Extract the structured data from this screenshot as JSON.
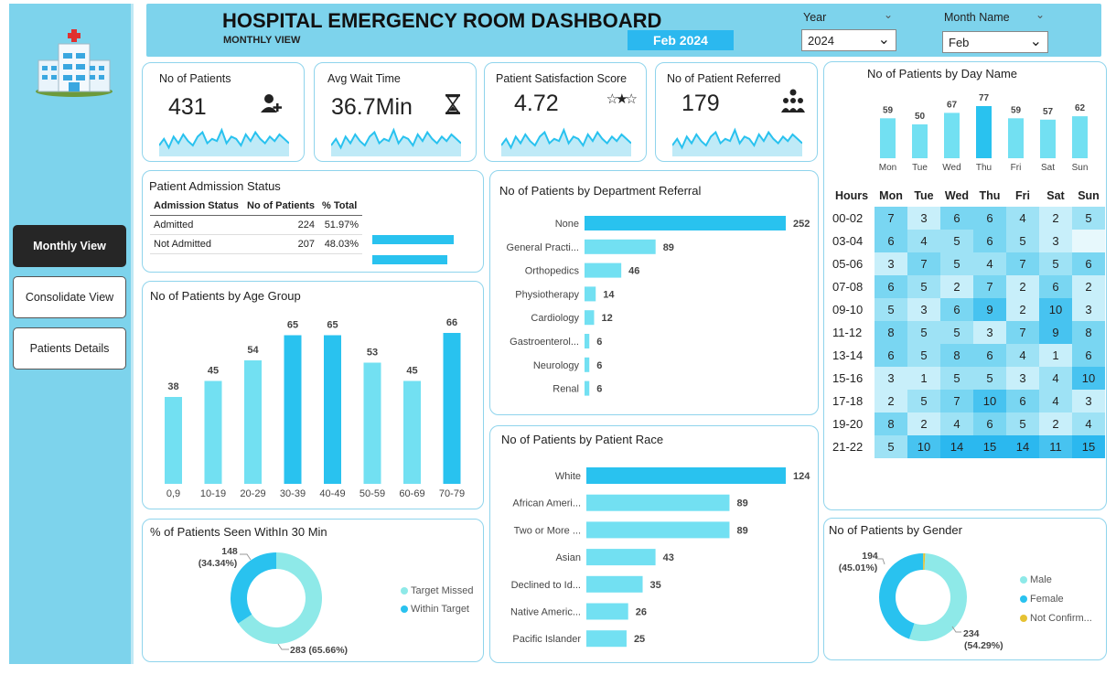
{
  "header": {
    "title": "HOSPITAL EMERGENCY ROOM DASHBOARD",
    "subtitle": "MONTHLY VIEW",
    "period_badge": "Feb 2024",
    "year_label": "Year",
    "year_value": "2024",
    "month_label": "Month Name",
    "month_value": "Feb"
  },
  "nav": {
    "items": [
      "Monthly View",
      "Consolidate View",
      "Patients Details"
    ],
    "active": 0
  },
  "kpis": [
    {
      "label": "No of Patients",
      "value": "431",
      "icon": "add-user-icon"
    },
    {
      "label": "Avg Wait Time",
      "value": "36.7Min",
      "icon": "hourglass-icon"
    },
    {
      "label": "Patient Satisfaction Score",
      "value": "4.72",
      "icon": "stars-icon"
    },
    {
      "label": "No of Patient Referred",
      "value": "179",
      "icon": "group-icon"
    }
  ],
  "admission": {
    "title": "Patient Admission Status",
    "columns": [
      "Admission Status",
      "No of Patients",
      "% Total"
    ],
    "rows": [
      {
        "status": "Admitted",
        "count": 224,
        "pct": "51.97%"
      },
      {
        "status": "Not Admitted",
        "count": 207,
        "pct": "48.03%"
      }
    ]
  },
  "colors": {
    "accent": "#7dd3ec",
    "bar_dark": "#29c2ef",
    "bar_light": "#72e0f2",
    "badge": "#2bb8ef",
    "missed": "#8ee9e8",
    "within": "#29c2ef",
    "notconfirmed": "#e6c233"
  },
  "chart_data": [
    {
      "id": "age",
      "type": "bar",
      "title": "No of Patients by Age Group",
      "categories": [
        "0,9",
        "10-19",
        "20-29",
        "30-39",
        "40-49",
        "50-59",
        "60-69",
        "70-79"
      ],
      "values": [
        38,
        45,
        54,
        65,
        65,
        53,
        45,
        66
      ]
    },
    {
      "id": "dept",
      "type": "bar",
      "orientation": "horizontal",
      "title": "No of Patients by Department Referral",
      "categories": [
        "None",
        "General Practi...",
        "Orthopedics",
        "Physiotherapy",
        "Cardiology",
        "Gastroenterol...",
        "Neurology",
        "Renal"
      ],
      "values": [
        252,
        89,
        46,
        14,
        12,
        6,
        6,
        6
      ]
    },
    {
      "id": "race",
      "type": "bar",
      "orientation": "horizontal",
      "title": "No of Patients by Patient Race",
      "categories": [
        "White",
        "African Ameri...",
        "Two or More ...",
        "Asian",
        "Declined to Id...",
        "Native Americ...",
        "Pacific Islander"
      ],
      "values": [
        124,
        89,
        89,
        43,
        35,
        26,
        25
      ]
    },
    {
      "id": "day",
      "type": "bar",
      "title": "No of Patients by Day Name",
      "categories": [
        "Mon",
        "Tue",
        "Wed",
        "Thu",
        "Fri",
        "Sat",
        "Sun"
      ],
      "values": [
        59,
        50,
        67,
        77,
        59,
        57,
        62
      ]
    },
    {
      "id": "seen30",
      "type": "pie",
      "title": "% of Patients Seen WithIn 30 Min",
      "series": [
        {
          "name": "Target Missed",
          "value": 283,
          "label": "283 (65.66%)"
        },
        {
          "name": "Within Target",
          "value": 148,
          "label": "148 (34.34%)"
        }
      ]
    },
    {
      "id": "gender",
      "type": "pie",
      "title": "No of Patients by Gender",
      "series": [
        {
          "name": "Male",
          "value": 234,
          "label": "234 (54.29%)"
        },
        {
          "name": "Female",
          "value": 194,
          "label": "194 (45.01%)"
        },
        {
          "name": "Not Confirm...",
          "value": 3,
          "label": ""
        }
      ]
    },
    {
      "id": "heatmap",
      "type": "heatmap",
      "xlabel": "",
      "ylabel": "",
      "corner": "Hours",
      "columns": [
        "Mon",
        "Tue",
        "Wed",
        "Thu",
        "Fri",
        "Sat",
        "Sun"
      ],
      "rows": [
        "00-02",
        "03-04",
        "05-06",
        "07-08",
        "09-10",
        "11-12",
        "13-14",
        "15-16",
        "17-18",
        "19-20",
        "21-22"
      ],
      "values": [
        [
          7,
          3,
          6,
          6,
          4,
          2,
          5
        ],
        [
          6,
          4,
          5,
          6,
          5,
          3,
          null
        ],
        [
          3,
          7,
          5,
          4,
          7,
          5,
          6
        ],
        [
          6,
          5,
          2,
          7,
          2,
          6,
          2
        ],
        [
          5,
          3,
          6,
          9,
          2,
          10,
          3
        ],
        [
          8,
          5,
          5,
          3,
          7,
          9,
          8
        ],
        [
          6,
          5,
          8,
          6,
          4,
          1,
          6
        ],
        [
          3,
          1,
          5,
          5,
          3,
          4,
          10
        ],
        [
          2,
          5,
          7,
          10,
          6,
          4,
          3
        ],
        [
          8,
          2,
          4,
          6,
          5,
          2,
          4
        ],
        [
          5,
          10,
          14,
          15,
          14,
          11,
          15
        ]
      ]
    },
    {
      "id": "spark",
      "type": "line",
      "note_values": [
        5,
        8,
        4,
        9,
        6,
        10,
        7,
        5,
        9,
        11,
        6,
        8,
        7,
        12,
        6,
        9,
        8,
        5,
        10,
        7,
        11,
        8,
        6,
        9,
        7,
        10,
        8,
        6
      ]
    }
  ]
}
